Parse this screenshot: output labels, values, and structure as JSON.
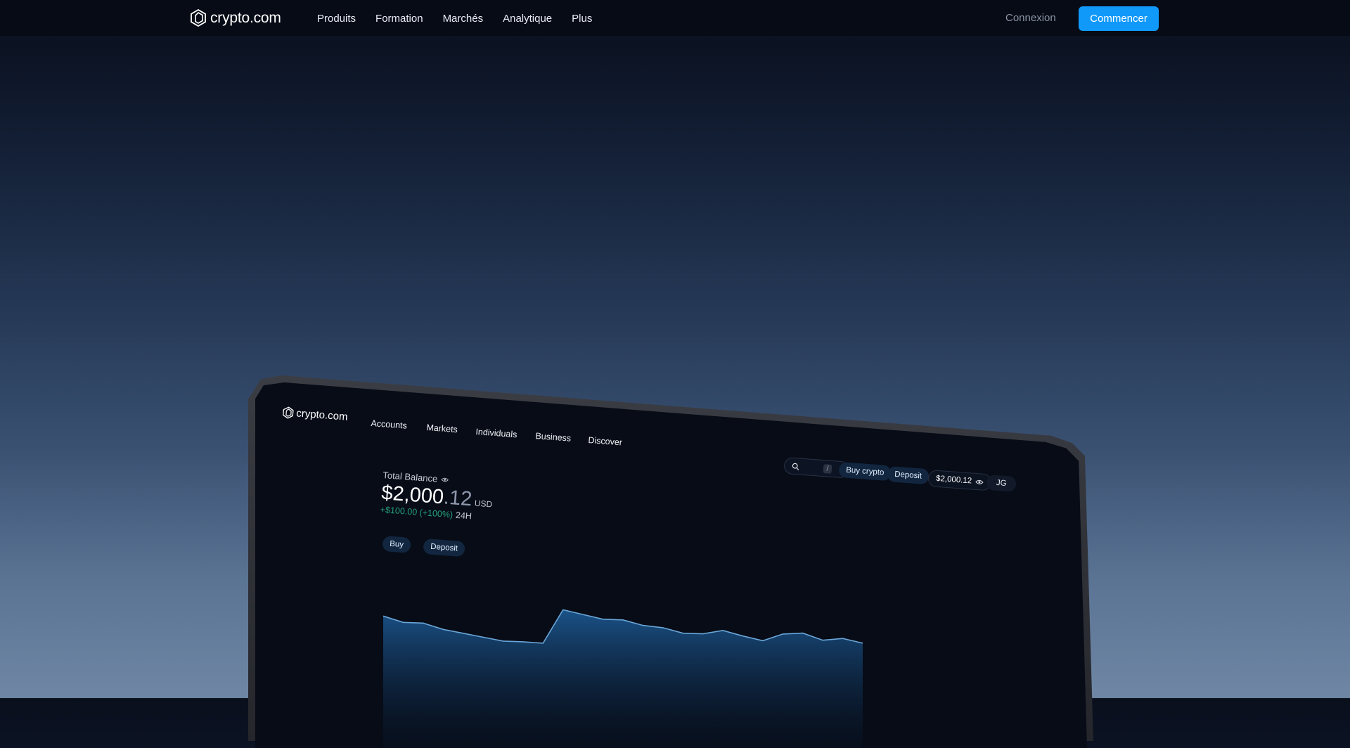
{
  "nav": {
    "logo_text": "crypto.com",
    "menu": [
      "Produits",
      "Formation",
      "Marchés",
      "Analytique",
      "Plus"
    ],
    "login": "Connexion",
    "cta": "Commencer"
  },
  "colors": {
    "accent": "#1199fa",
    "positive": "#26a17b",
    "nav_bg": "#070b16"
  },
  "device_screen": {
    "logo_text": "crypto.com",
    "menu": [
      "Accounts",
      "Markets",
      "Individuals",
      "Business",
      "Discover"
    ],
    "search_shortcut": "/",
    "buy_crypto": "Buy crypto",
    "deposit": "Deposit",
    "header_balance": "$2,000.12",
    "avatar": "JG",
    "total_balance_label": "Total Balance",
    "balance_main": "$2,000",
    "balance_cents": ".12",
    "balance_currency": "USD",
    "change": "+$100.00 (+100%)",
    "change_period": "24H",
    "buy": "Buy",
    "deposit_small": "Deposit",
    "chart_data": {
      "type": "area",
      "values": [
        52,
        49,
        49.5,
        46.5,
        45,
        43.5,
        42,
        42.5,
        42.5,
        64,
        62,
        60,
        60.5,
        58,
        57.5,
        55,
        55.5,
        58.5,
        56,
        54,
        59,
        60.5,
        57,
        59,
        57
      ]
    }
  }
}
